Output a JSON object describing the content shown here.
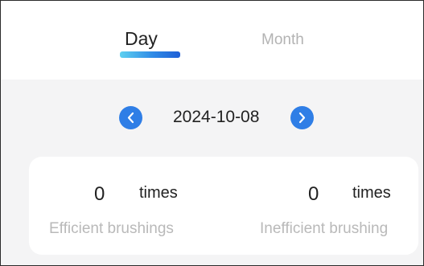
{
  "tabs": {
    "day_label": "Day",
    "month_label": "Month",
    "active": "Day"
  },
  "date_nav": {
    "date": "2024-10-08",
    "prev_icon": "chevron-left-icon",
    "next_icon": "chevron-right-icon"
  },
  "stats": {
    "efficient": {
      "value": "0",
      "unit": "times",
      "label": "Efficient brushings"
    },
    "inefficient": {
      "value": "0",
      "unit": "times",
      "label": "Inefficient brushing"
    }
  },
  "colors": {
    "accent": "#2f7ee6",
    "background": "#f4f4f5",
    "card": "#ffffff",
    "muted_text": "#b9b9b9"
  }
}
